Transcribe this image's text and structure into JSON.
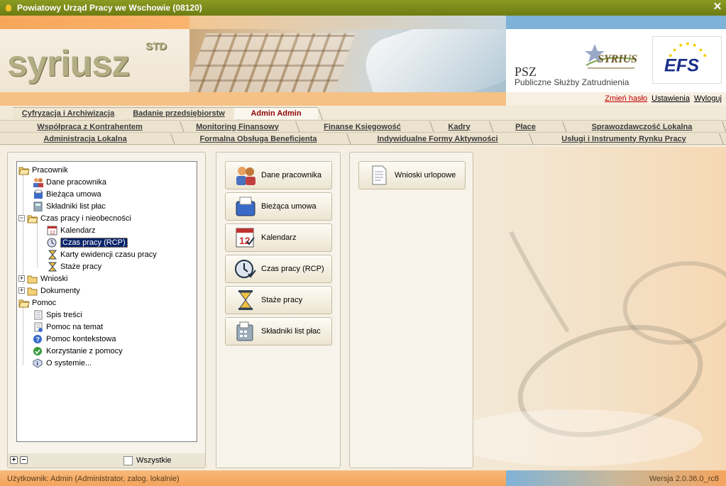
{
  "window": {
    "title": "Powiatowy Urząd Pracy we Wschowie (08120)"
  },
  "banner": {
    "logo": "syriusz",
    "logo_std": "STD",
    "psz_title": "PSZ",
    "psz_sub": "Publiczne Służby Zatrudnienia",
    "syr_small": "SYRIUSZ",
    "efs": "EFS",
    "links": {
      "change_password": "Zmień hasło",
      "settings": "Ustawienia",
      "logout": "Wyloguj"
    }
  },
  "tabs": {
    "row1": [
      "Cyfryzacja i Archiwizacja",
      "Badanie przedsiębiorstw",
      "Admin Admin"
    ],
    "row2": [
      "Współpraca z Kontrahentem",
      "Monitoring Finansowy",
      "Finanse Księgowość",
      "Kadry",
      "Płace",
      "Sprawozdawczość Lokalna"
    ],
    "row3": [
      "Administracja Lokalna",
      "Formalna Obsługa Beneficjenta",
      "Indywidualne Formy Aktywności",
      "Usługi i Instrumenty Rynku Pracy"
    ]
  },
  "tree": {
    "items": [
      "Pracownik",
      "Dane pracownika",
      "Bieżąca umowa",
      "Składniki list płac",
      "Czas pracy i nieobecności",
      "Kalendarz",
      "Czas pracy (RCP)",
      "Karty ewidencji czasu pracy",
      "Staże pracy",
      "Wnioski",
      "Dokumenty",
      "Pomoc",
      "Spis treści",
      "Pomoc na temat",
      "Pomoc kontekstowa",
      "Korzystanie z pomocy",
      "O systemie..."
    ],
    "all_label": "Wszystkie"
  },
  "buttons": {
    "mid": [
      "Dane pracownika",
      "Bieżąca umowa",
      "Kalendarz",
      "Czas pracy (RCP)",
      "Staże pracy",
      "Składniki list płac"
    ],
    "right": [
      "Wnioski urlopowe"
    ]
  },
  "status": {
    "user": "Użytkownik: Admin (Administrator, zalog. lokalnie)",
    "version": "Wersja 2.0.36.0_rc8"
  },
  "colors": {
    "title_bar": "#7a8a1a",
    "selected": "#0a246a",
    "active_tab_text": "#8a0000"
  }
}
